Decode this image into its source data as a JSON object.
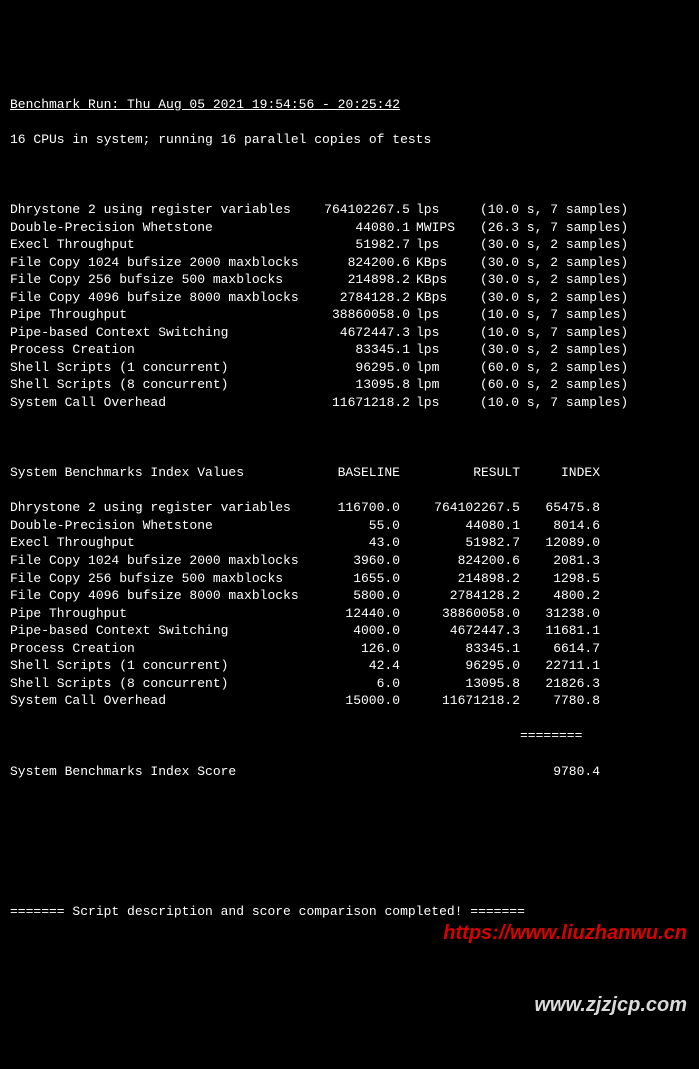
{
  "header": {
    "run_line": "Benchmark Run: Thu Aug 05 2021 19:54:56 - 20:25:42",
    "cpu_line": "16 CPUs in system; running 16 parallel copies of tests"
  },
  "tests": [
    {
      "name": "Dhrystone 2 using register variables",
      "value": "764102267.5",
      "unit": "lps",
      "timing": "(10.0 s, 7 samples)"
    },
    {
      "name": "Double-Precision Whetstone",
      "value": "44080.1",
      "unit": "MWIPS",
      "timing": "(26.3 s, 7 samples)"
    },
    {
      "name": "Execl Throughput",
      "value": "51982.7",
      "unit": "lps",
      "timing": "(30.0 s, 2 samples)"
    },
    {
      "name": "File Copy 1024 bufsize 2000 maxblocks",
      "value": "824200.6",
      "unit": "KBps",
      "timing": "(30.0 s, 2 samples)"
    },
    {
      "name": "File Copy 256 bufsize 500 maxblocks",
      "value": "214898.2",
      "unit": "KBps",
      "timing": "(30.0 s, 2 samples)"
    },
    {
      "name": "File Copy 4096 bufsize 8000 maxblocks",
      "value": "2784128.2",
      "unit": "KBps",
      "timing": "(30.0 s, 2 samples)"
    },
    {
      "name": "Pipe Throughput",
      "value": "38860058.0",
      "unit": "lps",
      "timing": "(10.0 s, 7 samples)"
    },
    {
      "name": "Pipe-based Context Switching",
      "value": "4672447.3",
      "unit": "lps",
      "timing": "(10.0 s, 7 samples)"
    },
    {
      "name": "Process Creation",
      "value": "83345.1",
      "unit": "lps",
      "timing": "(30.0 s, 2 samples)"
    },
    {
      "name": "Shell Scripts (1 concurrent)",
      "value": "96295.0",
      "unit": "lpm",
      "timing": "(60.0 s, 2 samples)"
    },
    {
      "name": "Shell Scripts (8 concurrent)",
      "value": "13095.8",
      "unit": "lpm",
      "timing": "(60.0 s, 2 samples)"
    },
    {
      "name": "System Call Overhead",
      "value": "11671218.2",
      "unit": "lps",
      "timing": "(10.0 s, 7 samples)"
    }
  ],
  "index_header": {
    "title": "System Benchmarks Index Values",
    "baseline": "BASELINE",
    "result": "RESULT",
    "index": "INDEX"
  },
  "indexes": [
    {
      "name": "Dhrystone 2 using register variables",
      "baseline": "116700.0",
      "result": "764102267.5",
      "index": "65475.8"
    },
    {
      "name": "Double-Precision Whetstone",
      "baseline": "55.0",
      "result": "44080.1",
      "index": "8014.6"
    },
    {
      "name": "Execl Throughput",
      "baseline": "43.0",
      "result": "51982.7",
      "index": "12089.0"
    },
    {
      "name": "File Copy 1024 bufsize 2000 maxblocks",
      "baseline": "3960.0",
      "result": "824200.6",
      "index": "2081.3"
    },
    {
      "name": "File Copy 256 bufsize 500 maxblocks",
      "baseline": "1655.0",
      "result": "214898.2",
      "index": "1298.5"
    },
    {
      "name": "File Copy 4096 bufsize 8000 maxblocks",
      "baseline": "5800.0",
      "result": "2784128.2",
      "index": "4800.2"
    },
    {
      "name": "Pipe Throughput",
      "baseline": "12440.0",
      "result": "38860058.0",
      "index": "31238.0"
    },
    {
      "name": "Pipe-based Context Switching",
      "baseline": "4000.0",
      "result": "4672447.3",
      "index": "11681.1"
    },
    {
      "name": "Process Creation",
      "baseline": "126.0",
      "result": "83345.1",
      "index": "6614.7"
    },
    {
      "name": "Shell Scripts (1 concurrent)",
      "baseline": "42.4",
      "result": "96295.0",
      "index": "22711.1"
    },
    {
      "name": "Shell Scripts (8 concurrent)",
      "baseline": "6.0",
      "result": "13095.8",
      "index": "21826.3"
    },
    {
      "name": "System Call Overhead",
      "baseline": "15000.0",
      "result": "11671218.2",
      "index": "7780.8"
    }
  ],
  "score": {
    "label": "System Benchmarks Index Score",
    "value": "9780.4",
    "separator": "========"
  },
  "footer": {
    "line": "======= Script description and score comparison completed! ======="
  },
  "watermark": {
    "line1": "https://www.liuzhanwu.cn",
    "line2": "www.zjzjcp.com"
  }
}
